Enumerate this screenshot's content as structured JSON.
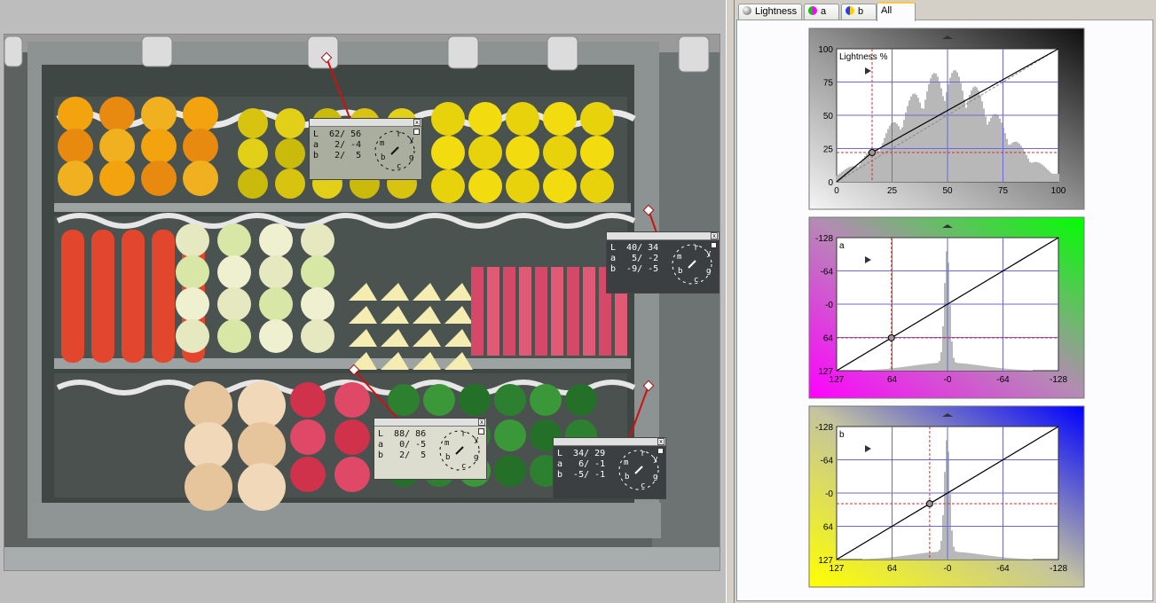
{
  "tabs": [
    {
      "label": "Lightness",
      "icon": "lightness-channel-icon"
    },
    {
      "label": "a",
      "icon": "a-channel-icon"
    },
    {
      "label": "b",
      "icon": "b-channel-icon"
    },
    {
      "label": "All",
      "icon": ""
    }
  ],
  "active_tab": "All",
  "probes": [
    {
      "id": "probe-1",
      "L": "L  62/ 56",
      "a": "a   2/ -4",
      "b": "b   2/  5",
      "style": "mid"
    },
    {
      "id": "probe-2",
      "L": "L  40/ 34",
      "a": "a   5/ -2",
      "b": "b  -9/ -5",
      "style": "dark"
    },
    {
      "id": "probe-3",
      "L": "L  88/ 86",
      "a": "a   0/ -5",
      "b": "b   2/  5",
      "style": "light"
    },
    {
      "id": "probe-4",
      "L": "L  34/ 29",
      "a": "a   6/ -1",
      "b": "b  -5/ -1",
      "style": "dark"
    }
  ],
  "dial_letters": [
    "m",
    "r",
    "y",
    "g",
    "c",
    "b"
  ],
  "close_glyph": "x",
  "curves": {
    "lightness": {
      "label": "Lightness %",
      "y_ticks": [
        "100",
        "75",
        "50",
        "25",
        "0"
      ],
      "x_ticks": [
        "0",
        "25",
        "50",
        "75",
        "100"
      ],
      "points": [
        [
          0,
          0
        ],
        [
          16,
          22
        ],
        [
          100,
          100
        ]
      ],
      "control_point": [
        16,
        22
      ],
      "histogram_peak_x": 50
    },
    "a": {
      "label": "a",
      "y_ticks": [
        "-128",
        "-64",
        "-0",
        "64",
        "127"
      ],
      "x_ticks": [
        "127",
        "64",
        "-0",
        "-64",
        "-128"
      ],
      "points": [
        [
          127,
          127
        ],
        [
          64,
          64
        ],
        [
          -128,
          -128
        ]
      ],
      "control_point": [
        64,
        64
      ],
      "histogram_peak_x": 0
    },
    "b": {
      "label": "b",
      "y_ticks": [
        "-128",
        "-64",
        "-0",
        "64",
        "127"
      ],
      "x_ticks": [
        "127",
        "64",
        "-0",
        "-64",
        "-128"
      ],
      "points": [
        [
          127,
          127
        ],
        [
          20,
          20
        ],
        [
          -128,
          -128
        ]
      ],
      "control_point": [
        20,
        20
      ],
      "histogram_peak_x": 0
    }
  },
  "colors": {
    "curve_bg_lightness_dark": "#111111",
    "curve_bg_lightness_light": "#f0f0f0",
    "a_magenta": "#ff00ff",
    "a_green": "#00ff00",
    "b_yellow": "#ffff00",
    "b_blue": "#0000ff",
    "grid": "#6a6ad8",
    "guide_red": "#d03030",
    "connector": "#d01010"
  }
}
